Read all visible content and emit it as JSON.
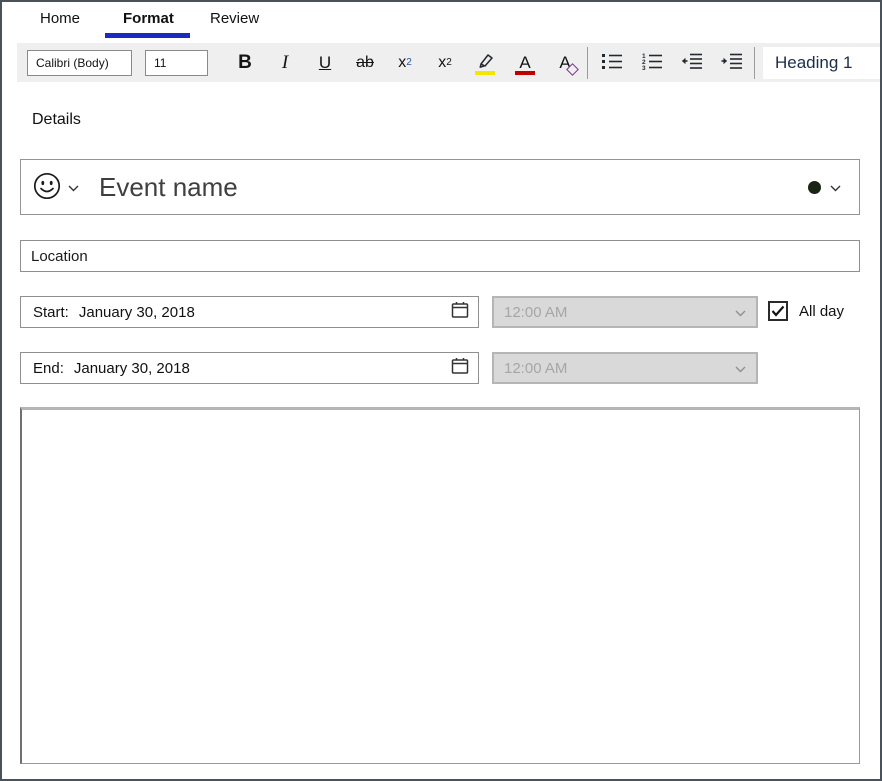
{
  "tabs": {
    "items": [
      {
        "label": "Home"
      },
      {
        "label": "Format"
      },
      {
        "label": "Review"
      }
    ],
    "active": "Format"
  },
  "ribbon": {
    "font_name_value": "Calibri (Body)",
    "font_size_value": "11",
    "bold_label": "B",
    "italic_label": "I",
    "underline_label": "U",
    "strikethrough_label": "ab",
    "subscript_base": "x",
    "subscript_script": "2",
    "superscript_base": "x",
    "superscript_script": "2",
    "font_color_label": "A",
    "clear_formatting_label": "A",
    "style_selected": "Heading 1"
  },
  "details": {
    "heading": "Details",
    "event_name_placeholder": "Event name",
    "location_placeholder": "Location",
    "start": {
      "label": "Start:",
      "date": "January 30, 2018",
      "time": "12:00 AM"
    },
    "end": {
      "label": "End:",
      "date": "January 30, 2018",
      "time": "12:00 AM"
    },
    "all_day_label": "All day",
    "all_day_checked": true
  },
  "colors": {
    "tab_accent": "#1b2bbf",
    "highlight_yellow": "#f5e500",
    "font_color_red": "#c00000",
    "clear_format_purple": "#7a2e8e",
    "subscript_blue": "#2b579a",
    "event_color_dot": "#1a2314",
    "style_text": "#1d2c4d",
    "disabled_bg": "#d9d9d9",
    "disabled_text": "#a6a6a6"
  }
}
